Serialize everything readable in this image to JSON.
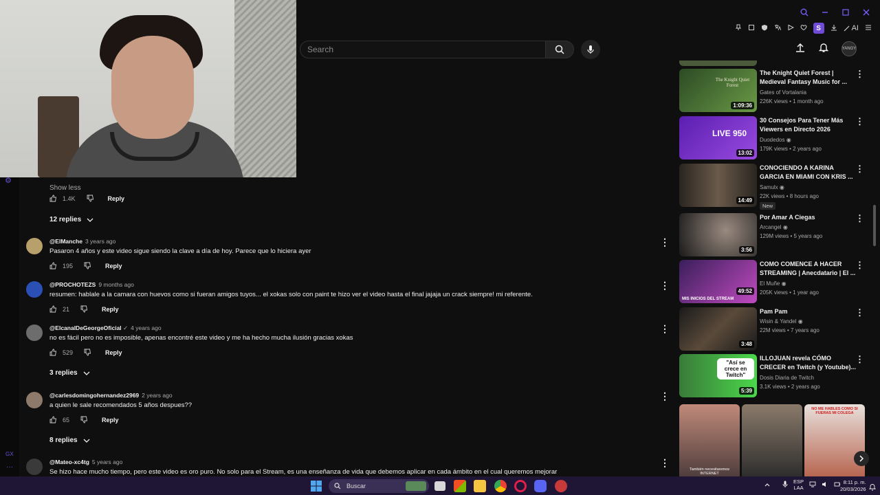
{
  "search": {
    "placeholder": "Search"
  },
  "header": {
    "account_label": "YANGY"
  },
  "extensions": {
    "ai_label": "AI",
    "s_badge": "S"
  },
  "comments": {
    "show_less": "Show less",
    "top_actions": {
      "likes": "1.4K",
      "reply": "Reply"
    },
    "top_replies": "12 replies",
    "items": [
      {
        "author": "@ElManche",
        "time": "3 years ago",
        "text": "Pasaron 4 años y este video sigue siendo la clave a día de hoy. Parece que lo hiciera ayer",
        "likes": "195",
        "reply": "Reply",
        "replies": "",
        "avatar_color": "#b7a06a"
      },
      {
        "author": "@PROCHOTEZS",
        "time": "9 months ago",
        "text": "resumen: hablale a la camara con huevos como si fueran amigos tuyos... el xokas solo con paint te hizo ver el video hasta el final jajaja un crack siempre! mi referente.",
        "likes": "21",
        "reply": "Reply",
        "replies": "",
        "avatar_color": "#2a4fb5"
      },
      {
        "author": "@ElcanalDeGeorgeOficial",
        "verified": "✓",
        "time": "4 years ago",
        "text": "no es fácil pero no es imposible, apenas encontré este video y me ha hecho mucha ilusión gracias xokas",
        "likes": "529",
        "reply": "Reply",
        "replies": "3 replies",
        "avatar_color": "#6d6d6d"
      },
      {
        "author": "@carlesdomingohernandez2969",
        "time": "2 years ago",
        "text": "a quien le sale recomendados 5 años despues??",
        "likes": "65",
        "reply": "Reply",
        "replies": "8 replies",
        "avatar_color": "#8d7a6a"
      },
      {
        "author": "@Mateo-xc4tg",
        "time": "5 years ago",
        "text": "Se hizo hace mucho tiempo, pero este video es oro puro. No solo para el Stream, es una enseñanza de vida que debemos aplicar en cada ámbito en el cual queremos mejorar",
        "likes": "",
        "reply": "",
        "replies": "",
        "avatar_color": "#3a3a3a"
      }
    ]
  },
  "sidebar": {
    "videos": [
      {
        "title": "The Knight Quiet Forest | Medieval Fantasy Music for ...",
        "channel": "Gates of Vortalania",
        "meta": "226K views • 1 month ago",
        "duration": "1:09:36",
        "thumb_color": "#3f6b2f",
        "thumb_text": "The Knight Quiet Forest",
        "verified": false,
        "badge": ""
      },
      {
        "title": "30 Consejos Para Tener Más Viewers en Directo 2026",
        "channel": "Duodedos",
        "meta": "179K views • 2 years ago",
        "duration": "13:02",
        "thumb_color": "#7a2fd0",
        "thumb_text": "LIVE 950",
        "verified": true,
        "badge": ""
      },
      {
        "title": "CONOCIENDO A KARINA GARCIA EN MIAMI CON KRIS ...",
        "channel": "Samulx",
        "meta": "22K views • 8 hours ago",
        "duration": "14:49",
        "thumb_color": "#3a332c",
        "thumb_text": "",
        "verified": true,
        "badge": "New"
      },
      {
        "title": "Por Amar A Ciegas",
        "channel": "Arcangel",
        "meta": "129M views • 5 years ago",
        "duration": "3:56",
        "thumb_color": "#4a4a4a",
        "thumb_text": "",
        "verified": true,
        "badge": ""
      },
      {
        "title": "COMO COMENCE A HACER STREAMING | Anecdatario | El ...",
        "channel": "El Muñe",
        "meta": "205K views • 1 year ago",
        "duration": "49:52",
        "thumb_color": "#5a2a6a",
        "thumb_text": "MIS INICIOS DEL STREAM",
        "verified": true,
        "badge": ""
      },
      {
        "title": "Pam Pam",
        "channel": "Wisin & Yandel",
        "meta": "22M views • 7 years ago",
        "duration": "3:48",
        "thumb_color": "#2c2c2c",
        "thumb_text": "",
        "verified": true,
        "badge": ""
      },
      {
        "title": "ILLOJUAN revela CÓMO CRECER en Twitch (y Youtube)...",
        "channel": "Dosis Diaria de Twitch",
        "meta": "3.1K views • 2 years ago",
        "duration": "5:39",
        "thumb_color": "#3fbf3a",
        "thumb_text": "\"Así se crece en Twitch\"",
        "verified": false,
        "badge": ""
      }
    ],
    "shorts": [
      {
        "caption": "También necesitaremos INTERNET",
        "color": "#a86a5a"
      },
      {
        "caption": "",
        "color": "#6a5a4a"
      },
      {
        "caption": "NO ME HABLES COMO SI FUERAS MI COLEGA",
        "color": "#b5504a"
      }
    ]
  },
  "taskbar": {
    "search_label": "Buscar",
    "lang": "ESP",
    "lang2": "LAA",
    "time": "8:11 p. m.",
    "date": "20/03/2026"
  },
  "gx": {
    "label": "GX"
  }
}
